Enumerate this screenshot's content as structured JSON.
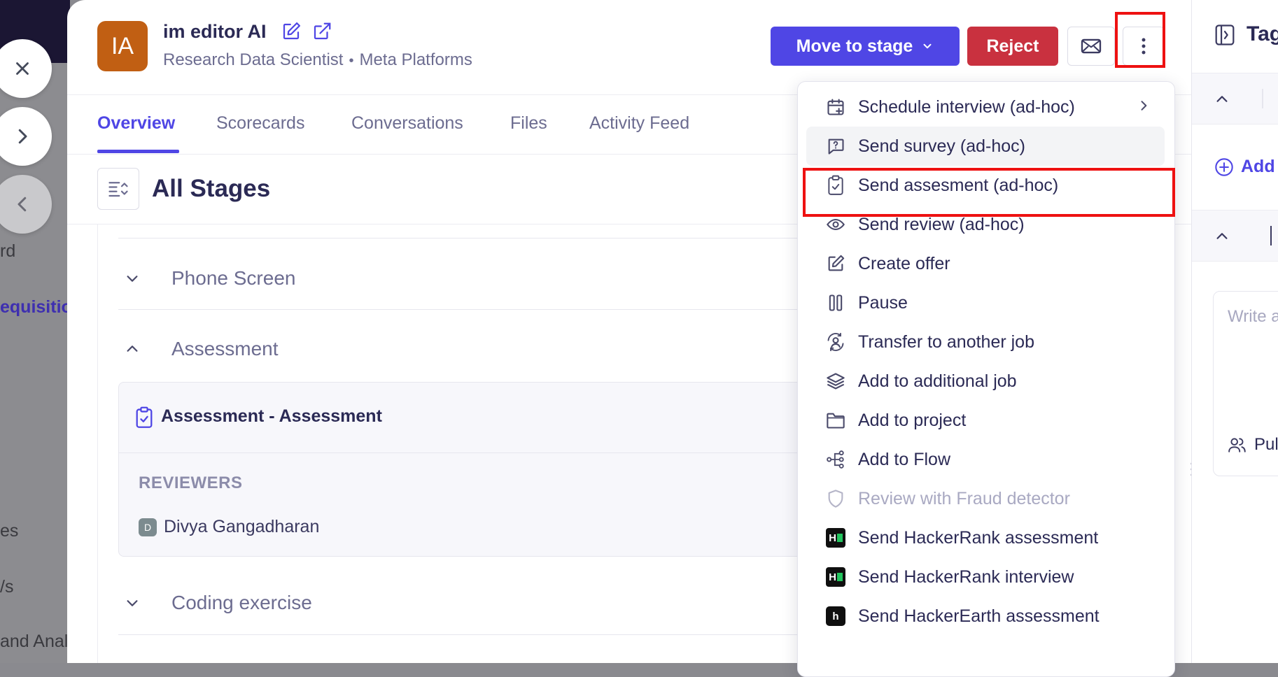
{
  "sidebar_fragments": [
    {
      "text": "rd",
      "selected": false
    },
    {
      "text": "equisitio",
      "selected": true
    },
    {
      "text": "es",
      "selected": false
    },
    {
      "text": "/s",
      "selected": false
    },
    {
      "text": "and Anal",
      "selected": false
    }
  ],
  "nav": {
    "close_icon": "x-icon",
    "next_icon": "chevron-right-icon",
    "prev_icon": "chevron-left-icon"
  },
  "candidate": {
    "initials": "IA",
    "name": "im editor AI",
    "title": "Research Data Scientist",
    "separator": "•",
    "company": "Meta Platforms",
    "avatar_color": "#c15f13"
  },
  "actions": {
    "move_label": "Move to stage",
    "reject_label": "Reject",
    "primary_color": "#4f46e5",
    "reject_color": "#c9313f"
  },
  "tabs": [
    {
      "label": "Overview",
      "active": true
    },
    {
      "label": "Scorecards",
      "active": false
    },
    {
      "label": "Conversations",
      "active": false
    },
    {
      "label": "Files",
      "active": false
    },
    {
      "label": "Activity Feed",
      "active": false
    }
  ],
  "stages": {
    "title": "All Stages",
    "items": [
      {
        "label": "Phone Screen",
        "expanded": false
      },
      {
        "label": "Assessment",
        "expanded": true
      },
      {
        "label": "Coding exercise",
        "expanded": false
      }
    ],
    "assessment_card": {
      "title": "Assessment - Assessment",
      "reviewers_label": "REVIEWERS",
      "reviewer_initial": "D",
      "reviewer_name": "Divya Gangadharan"
    }
  },
  "right_panel": {
    "title": "Tag",
    "add_label": "Add",
    "note_placeholder": "Write a",
    "visibility_label": "Pul"
  },
  "menu": {
    "items": [
      {
        "label": "Schedule interview (ad-hoc)",
        "icon": "calendar-plus-icon",
        "submenu": true
      },
      {
        "label": "Send survey (ad-hoc)",
        "icon": "survey-question-icon",
        "hover": true
      },
      {
        "label": "Send assesment (ad-hoc)",
        "icon": "clipboard-check-icon",
        "highlighted": true
      },
      {
        "label": "Send review (ad-hoc)",
        "icon": "eye-icon"
      },
      {
        "label": "Create offer",
        "icon": "edit-icon"
      },
      {
        "label": "Pause",
        "icon": "pause-icon"
      },
      {
        "label": "Transfer to another job",
        "icon": "transfer-user-icon"
      },
      {
        "label": "Add to additional job",
        "icon": "layers-icon"
      },
      {
        "label": "Add to project",
        "icon": "folder-icon"
      },
      {
        "label": "Add to Flow",
        "icon": "flow-icon"
      },
      {
        "label": "Review with Fraud detector",
        "icon": "shield-icon",
        "disabled": true
      },
      {
        "label": "Send HackerRank assessment",
        "icon": "hackerrank-logo-icon"
      },
      {
        "label": "Send HackerRank interview",
        "icon": "hackerrank-logo-icon"
      },
      {
        "label": "Send HackerEarth assessment",
        "icon": "hackerearth-logo-icon"
      }
    ]
  }
}
